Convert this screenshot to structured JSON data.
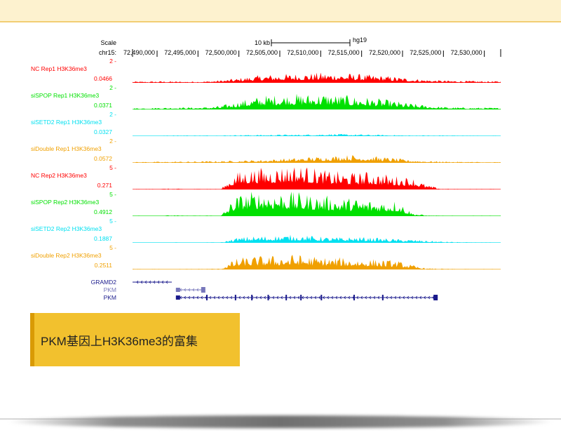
{
  "browser": {
    "scale_label": "Scale",
    "scale_bar_label": "10 kb",
    "assembly": "hg19",
    "chrom_label": "chr15:",
    "x_ticks": [
      "72,490,000",
      "72,495,000",
      "72,500,000",
      "72,505,000",
      "72,510,000",
      "72,515,000",
      "72,520,000",
      "72,525,000",
      "72,530,000"
    ]
  },
  "chart_data": {
    "type": "area",
    "x_range": [
      72487000,
      72532000
    ],
    "x_ticks": [
      72490000,
      72495000,
      72500000,
      72505000,
      72510000,
      72515000,
      72520000,
      72525000,
      72530000
    ],
    "tracks": [
      {
        "name": "NC Rep1 H3K36me3",
        "color": "#ff0000",
        "ymax_label": "2",
        "ymin_label": "0.0466",
        "profile": [
          0.05,
          0.05,
          0.06,
          0.05,
          0.05,
          0.06,
          0.1,
          0.16,
          0.24,
          0.3,
          0.32,
          0.34,
          0.36,
          0.38,
          0.36,
          0.34,
          0.3,
          0.27,
          0.22,
          0.16,
          0.12,
          0.09,
          0.08,
          0.07,
          0.06,
          0.06
        ]
      },
      {
        "name": "siSPOP Rep1 H3K36me3",
        "color": "#00e000",
        "ymax_label": "2",
        "ymin_label": "0.0371",
        "profile": [
          0.05,
          0.06,
          0.07,
          0.08,
          0.08,
          0.09,
          0.14,
          0.28,
          0.42,
          0.52,
          0.55,
          0.58,
          0.58,
          0.6,
          0.55,
          0.5,
          0.45,
          0.38,
          0.3,
          0.22,
          0.15,
          0.1,
          0.08,
          0.07,
          0.07,
          0.06
        ]
      },
      {
        "name": "siSETD2 Rep1 H3K36me3",
        "color": "#00e0f0",
        "ymax_label": "2",
        "ymin_label": "0.0327",
        "profile": [
          0.02,
          0.02,
          0.02,
          0.03,
          0.03,
          0.03,
          0.03,
          0.04,
          0.05,
          0.05,
          0.06,
          0.06,
          0.07,
          0.08,
          0.08,
          0.07,
          0.06,
          0.05,
          0.04,
          0.03,
          0.03,
          0.03,
          0.03,
          0.02,
          0.02,
          0.02
        ]
      },
      {
        "name": "siDouble Rep1 H3K36me3",
        "color": "#f0a000",
        "ymax_label": "2",
        "ymin_label": "0.0572",
        "profile": [
          0.03,
          0.04,
          0.04,
          0.05,
          0.05,
          0.06,
          0.07,
          0.08,
          0.1,
          0.12,
          0.15,
          0.18,
          0.22,
          0.24,
          0.28,
          0.3,
          0.26,
          0.22,
          0.16,
          0.1,
          0.07,
          0.05,
          0.04,
          0.04,
          0.03,
          0.03
        ]
      },
      {
        "name": "NC Rep2 H3K36me3",
        "color": "#ff0000",
        "ymax_label": "5",
        "ymin_label": "0.271",
        "profile": [
          0.02,
          0.02,
          0.03,
          0.03,
          0.02,
          0.03,
          0.02,
          0.62,
          0.78,
          0.8,
          0.86,
          0.92,
          0.84,
          0.7,
          0.66,
          0.62,
          0.66,
          0.58,
          0.5,
          0.45,
          0.16,
          0.03,
          0.02,
          0.02,
          0.02,
          0.02
        ]
      },
      {
        "name": "siSPOP Rep2 H3K36me3",
        "color": "#00e000",
        "ymax_label": "5",
        "ymin_label": "0.4912",
        "profile": [
          0.02,
          0.02,
          0.03,
          0.03,
          0.02,
          0.03,
          0.02,
          0.75,
          0.9,
          0.95,
          0.92,
          0.88,
          0.8,
          0.76,
          0.7,
          0.66,
          0.62,
          0.58,
          0.6,
          0.12,
          0.03,
          0.02,
          0.02,
          0.02,
          0.02,
          0.02
        ]
      },
      {
        "name": "siSETD2 Rep2 H3K36me3",
        "color": "#00e0f0",
        "ymax_label": "5",
        "ymin_label": "0.1887",
        "profile": [
          0.01,
          0.01,
          0.01,
          0.02,
          0.01,
          0.02,
          0.02,
          0.18,
          0.24,
          0.26,
          0.28,
          0.3,
          0.26,
          0.22,
          0.2,
          0.22,
          0.2,
          0.17,
          0.14,
          0.12,
          0.08,
          0.05,
          0.03,
          0.02,
          0.02,
          0.01
        ]
      },
      {
        "name": "siDouble Rep2 H3K36me3",
        "color": "#f0a000",
        "ymax_label": "5",
        "ymin_label": "0.2511",
        "profile": [
          0.02,
          0.02,
          0.02,
          0.02,
          0.02,
          0.03,
          0.03,
          0.4,
          0.48,
          0.5,
          0.52,
          0.56,
          0.5,
          0.46,
          0.44,
          0.42,
          0.4,
          0.36,
          0.32,
          0.16,
          0.04,
          0.03,
          0.02,
          0.02,
          0.02,
          0.02
        ]
      }
    ],
    "genes": [
      {
        "name": "GRAMD2",
        "color": "#1a1a8c",
        "start": 72487000,
        "end": 72491800
      },
      {
        "name": "PKM",
        "color": "#7777bb",
        "start": 72492300,
        "end": 72495900
      },
      {
        "name": "PKM",
        "color": "#1a1a8c",
        "start": 72492300,
        "end": 72524300
      }
    ]
  },
  "caption": "PKM基因上H3K36me3的富集"
}
